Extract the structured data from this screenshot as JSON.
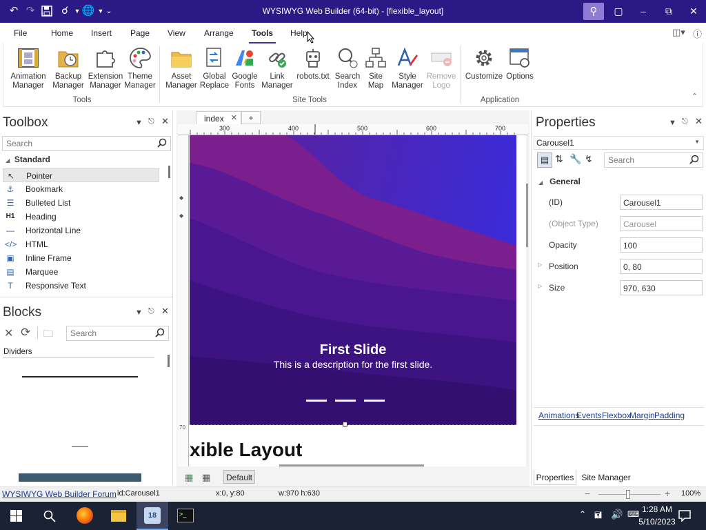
{
  "window": {
    "title": "WYSIWYG Web Builder (64-bit) - [flexible_layout]"
  },
  "menu": {
    "items": [
      "File",
      "Home",
      "Insert",
      "Page",
      "View",
      "Arrange",
      "Tools",
      "Help"
    ],
    "active": "Tools"
  },
  "ribbon": {
    "buttons": [
      {
        "l1": "Animation",
        "l2": "Manager"
      },
      {
        "l1": "Backup",
        "l2": "Manager"
      },
      {
        "l1": "Extension",
        "l2": "Manager"
      },
      {
        "l1": "Theme",
        "l2": "Manager"
      },
      {
        "l1": "Asset",
        "l2": "Manager"
      },
      {
        "l1": "Global",
        "l2": "Replace"
      },
      {
        "l1": "Google",
        "l2": "Fonts"
      },
      {
        "l1": "Link",
        "l2": "Manager"
      },
      {
        "l1": "robots.txt",
        "l2": ""
      },
      {
        "l1": "Search",
        "l2": "Index"
      },
      {
        "l1": "Site",
        "l2": "Map"
      },
      {
        "l1": "Style",
        "l2": "Manager"
      },
      {
        "l1": "Remove",
        "l2": "Logo"
      },
      {
        "l1": "Customize",
        "l2": ""
      },
      {
        "l1": "Options",
        "l2": ""
      }
    ],
    "groups": [
      "Tools",
      "Site Tools",
      "Application"
    ]
  },
  "toolbox": {
    "title": "Toolbox",
    "search_placeholder": "Search",
    "section": "Standard",
    "items": [
      {
        "label": "Pointer",
        "icon": "pointer-icon",
        "glyph": "↖"
      },
      {
        "label": "Bookmark",
        "icon": "anchor-icon",
        "glyph": "⚓"
      },
      {
        "label": "Bulleted List",
        "icon": "list-icon",
        "glyph": "☰"
      },
      {
        "label": "Heading",
        "icon": "heading-icon",
        "glyph": "H1"
      },
      {
        "label": "Horizontal Line",
        "icon": "line-icon",
        "glyph": "—"
      },
      {
        "label": "HTML",
        "icon": "code-icon",
        "glyph": "</>"
      },
      {
        "label": "Inline Frame",
        "icon": "frame-icon",
        "glyph": "▣"
      },
      {
        "label": "Marquee",
        "icon": "marquee-icon",
        "glyph": "▤"
      },
      {
        "label": "Responsive Text",
        "icon": "text-icon",
        "glyph": "T"
      }
    ]
  },
  "blocks": {
    "title": "Blocks",
    "search_placeholder": "Search",
    "category": "Dividers"
  },
  "editor": {
    "tab": "index",
    "add_tab": "+",
    "ruler": [
      "300",
      "400",
      "500",
      "600",
      "700"
    ],
    "slide_title": "First Slide",
    "slide_desc": "This is a description for the first slide.",
    "below_text": "xible Layout",
    "vruler_label": "70",
    "breakpoint": "Default"
  },
  "properties": {
    "title": "Properties",
    "selector": "Carousel1",
    "search_placeholder": "Search",
    "section": "General",
    "rows": [
      {
        "label": "(ID)",
        "value": "Carousel1",
        "disabled": false
      },
      {
        "label": "(Object Type)",
        "value": "Carousel",
        "disabled": true
      },
      {
        "label": "Opacity",
        "value": "100",
        "disabled": false
      },
      {
        "label": "Position",
        "value": "0, 80",
        "disabled": false
      },
      {
        "label": "Size",
        "value": "970, 630",
        "disabled": false
      }
    ],
    "links": [
      "Animations",
      "Events",
      "Flexbox",
      "Margin",
      "Padding"
    ],
    "bottom_tabs": [
      "Properties",
      "Site Manager"
    ]
  },
  "status": {
    "forum": "WYSIWYG Web Builder Forum",
    "id": "id:Carousel1",
    "xy": "x:0, y:80",
    "wh": "w:970 h:630",
    "zoom": "100%"
  },
  "taskbar": {
    "time": "1:28 AM",
    "date": "5/10/2023",
    "badge": "18"
  },
  "colors": {
    "title_bg": "#2b1a86",
    "accent": "#3a2ea0"
  }
}
